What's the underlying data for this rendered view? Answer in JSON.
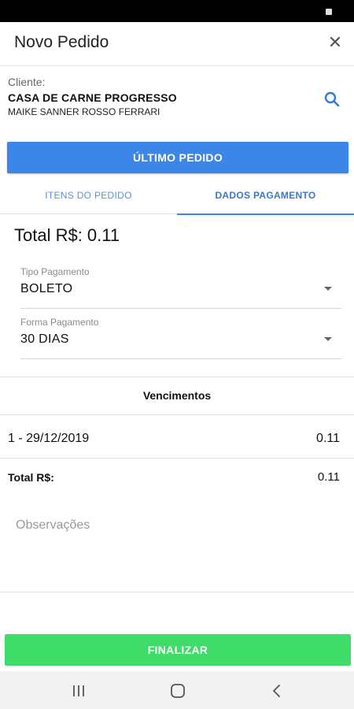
{
  "app_bar": {
    "title": "Novo Pedido",
    "close_icon": "close-icon"
  },
  "client": {
    "label": "Cliente:",
    "name": "CASA DE CARNE PROGRESSO",
    "contact": "MAIKE SANNER ROSSO FERRARI",
    "search_icon": "search-icon"
  },
  "last_order_button": "ÚLTIMO PEDIDO",
  "tabs": [
    {
      "label": "ITENS DO PEDIDO",
      "active": false
    },
    {
      "label": "DADOS PAGAMENTO",
      "active": true
    }
  ],
  "payment": {
    "total_label": "Total R$: 0.11",
    "tipo_label": "Tipo Pagamento",
    "tipo_value": "BOLETO",
    "forma_label": "Forma Pagamento",
    "forma_value": "30 DIAS"
  },
  "vencimentos": {
    "title": "Vencimentos",
    "installments": [
      {
        "label": "1 - 29/12/2019",
        "value": "0.11"
      }
    ],
    "total_label": "Total R$:",
    "total_value": "0.11"
  },
  "observations_placeholder": "Observações",
  "finalize_button": "FINALIZAR",
  "colors": {
    "primary": "#3b86e8",
    "tab_indicator": "#3a86e0",
    "finalize": "#3fdc6a",
    "status_bar": "#000000"
  }
}
